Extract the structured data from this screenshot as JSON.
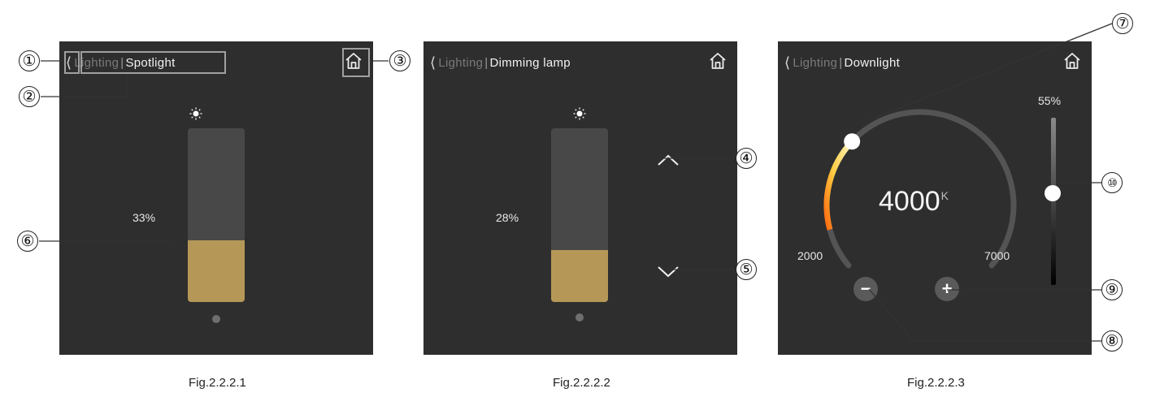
{
  "panels": [
    {
      "header": {
        "back_icon": "chevron-left-icon",
        "crumb": "Lighting",
        "separator": "|",
        "title": "Spotlight",
        "home_icon": "home-icon"
      },
      "brightness": {
        "percent_label": "33%",
        "level": 0.33,
        "icon": "sun-icon"
      },
      "caption": "Fig.2.2.2.1"
    },
    {
      "header": {
        "back_icon": "chevron-left-icon",
        "crumb": "Lighting",
        "separator": "|",
        "title": "Dimming lamp",
        "home_icon": "home-icon"
      },
      "brightness": {
        "percent_label": "28%",
        "level": 0.28,
        "icon": "sun-icon"
      },
      "controls": {
        "up_icon": "chevron-up-icon",
        "down_icon": "chevron-down-icon"
      },
      "caption": "Fig.2.2.2.2"
    },
    {
      "header": {
        "back_icon": "chevron-left-icon",
        "crumb": "Lighting",
        "separator": "|",
        "title": "Downlight",
        "home_icon": "home-icon"
      },
      "color_temp": {
        "value": "4000",
        "unit": "K",
        "min_label": "2000",
        "max_label": "7000",
        "value_k": 4000,
        "min_k": 2000,
        "max_k": 7000
      },
      "brightness": {
        "percent_label": "55%",
        "level": 0.55
      },
      "controls": {
        "minus_label": "−",
        "plus_label": "+"
      },
      "caption": "Fig.2.2.2.3"
    }
  ],
  "callouts": [
    "①",
    "②",
    "③",
    "④",
    "⑤",
    "⑥",
    "⑦",
    "⑧",
    "⑨",
    "⑩"
  ],
  "colors": {
    "panel_bg": "#2e2e2e",
    "fill_gold": "#b59857",
    "track": "#484848",
    "text": "#f2f2f2",
    "crumb": "#7a7a7a"
  }
}
